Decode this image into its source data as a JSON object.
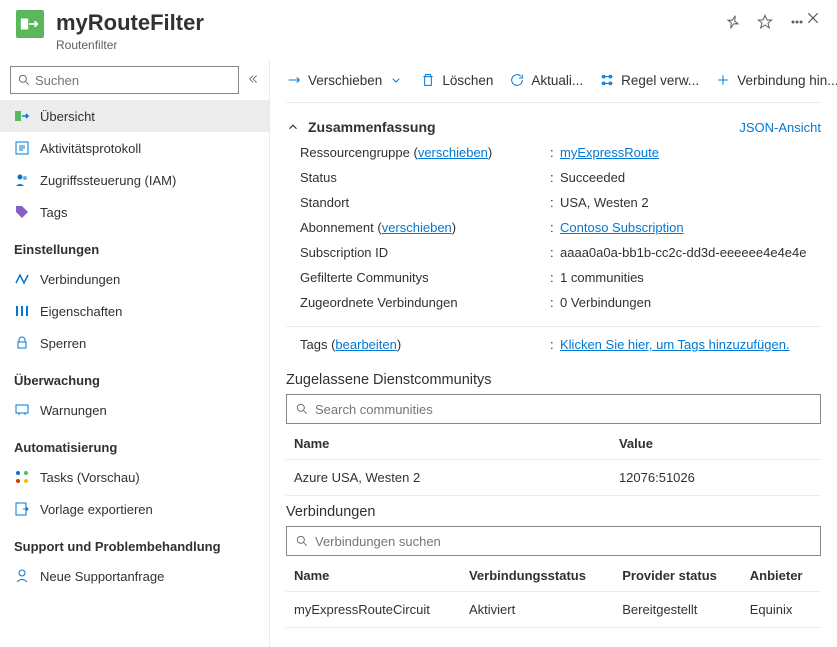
{
  "header": {
    "title": "myRouteFilter",
    "subtitle": "Routenfilter"
  },
  "search": {
    "placeholder": "Suchen"
  },
  "nav": {
    "items": [
      {
        "label": "Übersicht"
      },
      {
        "label": "Aktivitätsprotokoll"
      },
      {
        "label": "Zugriffssteuerung (IAM)"
      },
      {
        "label": "Tags"
      }
    ],
    "groups": [
      {
        "title": "Einstellungen",
        "items": [
          {
            "label": "Verbindungen"
          },
          {
            "label": "Eigenschaften"
          },
          {
            "label": "Sperren"
          }
        ]
      },
      {
        "title": "Überwachung",
        "items": [
          {
            "label": "Warnungen"
          }
        ]
      },
      {
        "title": "Automatisierung",
        "items": [
          {
            "label": "Tasks (Vorschau)"
          },
          {
            "label": "Vorlage exportieren"
          }
        ]
      },
      {
        "title": "Support und Problembehandlung",
        "items": [
          {
            "label": "Neue Supportanfrage"
          }
        ]
      }
    ]
  },
  "toolbar": {
    "move": "Verschieben",
    "delete": "Löschen",
    "refresh": "Aktuali...",
    "manage_rule": "Regel verw...",
    "add_connection": "Verbindung hin..."
  },
  "summary": {
    "title": "Zusammenfassung",
    "json_link": "JSON-Ansicht",
    "rows": {
      "resource_group_label": "Ressourcengruppe",
      "resource_group_move": "verschieben",
      "resource_group_val": "myExpressRoute",
      "status_label": "Status",
      "status_val": "Succeeded",
      "location_label": "Standort",
      "location_val": "USA, Westen 2",
      "subscription_label": "Abonnement",
      "subscription_move": "verschieben",
      "subscription_val": "Contoso Subscription",
      "subid_label": "Subscription ID",
      "subid_val": "aaaa0a0a-bb1b-cc2c-dd3d-eeeeee4e4e4e",
      "communities_label": "Gefilterte Communitys",
      "communities_val": "1 communities",
      "conns_label": "Zugeordnete Verbindungen",
      "conns_val": "0 Verbindungen",
      "tags_label": "Tags",
      "tags_edit": "bearbeiten",
      "tags_val": "Klicken Sie hier, um Tags hinzuzufügen."
    }
  },
  "communities": {
    "title": "Zugelassene Dienstcommunitys",
    "search_placeholder": "Search communities",
    "col_name": "Name",
    "col_value": "Value",
    "rows": [
      {
        "name": "Azure USA, Westen 2",
        "value": "12076:51026"
      }
    ]
  },
  "connections": {
    "title": "Verbindungen",
    "search_placeholder": "Verbindungen suchen",
    "col_name": "Name",
    "col_status": "Verbindungsstatus",
    "col_provider_status": "Provider status",
    "col_provider": "Anbieter",
    "rows": [
      {
        "name": "myExpressRouteCircuit",
        "status": "Aktiviert",
        "provider_status": "Bereitgestellt",
        "provider": "Equinix"
      }
    ]
  }
}
